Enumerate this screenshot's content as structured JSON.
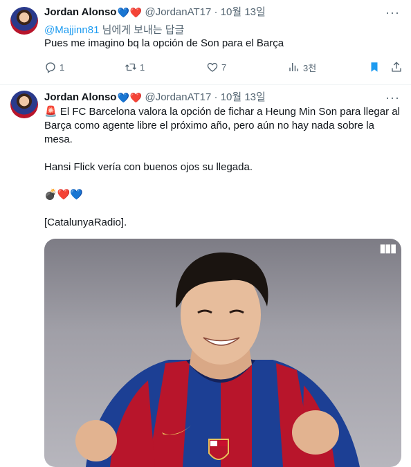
{
  "reply_tweet": {
    "author_name": "Jordan Alonso",
    "name_hearts": [
      "💙",
      "❤️"
    ],
    "handle": "@JordanAT17",
    "separator": "·",
    "date": "10월 13일",
    "more": "···",
    "reply_mention": "@Majjinn81",
    "reply_suffix": " 님에게 보내는 답글",
    "text": "Pues me imagino bq la opción de Son para el Barça",
    "actions": {
      "replies": "1",
      "retweets": "1",
      "likes": "7",
      "views": "3천"
    }
  },
  "main_tweet": {
    "author_name": "Jordan Alonso",
    "name_hearts": [
      "💙",
      "❤️"
    ],
    "handle": "@JordanAT17",
    "separator": "·",
    "date": "10월 13일",
    "more": "···",
    "text_line1": "🚨 El FC Barcelona valora la opción de fichar a Heung Min Son para llegar al Barça como agente libre el próximo año, pero aún no hay nada sobre la mesa.",
    "text_line2": "Hansi Flick vería con buenos ojos su llegada.",
    "text_emoji": "💣❤️💙",
    "text_source": "[CatalunyaRadio].",
    "media_dots": "▮▮▮"
  },
  "colors": {
    "accent": "#1d9bf0",
    "muted": "#536471",
    "bookmark": "#1d9bf0",
    "barca_blue": "#1c3f94",
    "barca_red": "#b8152b"
  },
  "icons": [
    "reply-icon",
    "retweet-icon",
    "like-icon",
    "views-icon",
    "bookmark-icon",
    "share-icon",
    "more-icon"
  ]
}
